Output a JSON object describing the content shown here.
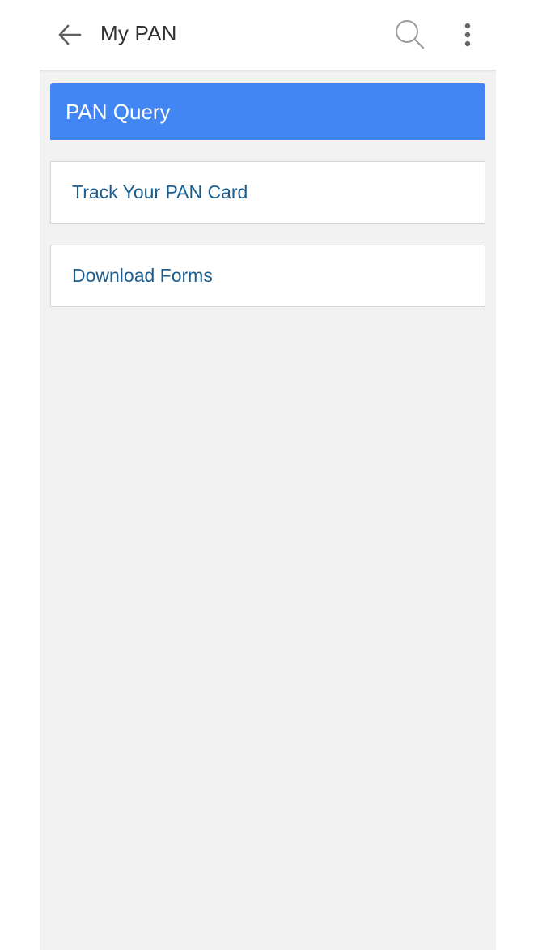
{
  "app_bar": {
    "title": "My PAN",
    "back_icon": "arrow-left-icon",
    "search_icon": "search-icon",
    "more_icon": "more-vertical-icon"
  },
  "section": {
    "title": "PAN Query",
    "header_color": "#4286f4"
  },
  "menu_items": [
    {
      "label": "Track Your PAN Card"
    },
    {
      "label": "Download Forms"
    }
  ],
  "colors": {
    "link_text": "#1b5e8f",
    "background": "#f2f2f2"
  }
}
